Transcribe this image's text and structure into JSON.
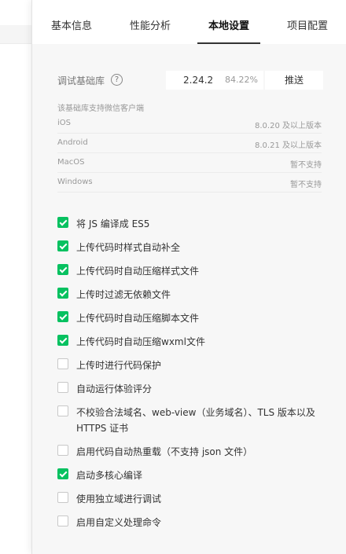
{
  "tabs": [
    {
      "label": "基本信息"
    },
    {
      "label": "性能分析"
    },
    {
      "label": "本地设置"
    },
    {
      "label": "项目配置"
    }
  ],
  "debug_lib": {
    "label": "调试基础库",
    "help_icon": "question-circle-icon",
    "version": "2.24.2",
    "percent": "84.22%",
    "push_label": "推送"
  },
  "support": {
    "title": "该基础库支持微信客户端",
    "rows": [
      {
        "os": "iOS",
        "version": "8.0.20 及以上版本"
      },
      {
        "os": "Android",
        "version": "8.0.21 及以上版本"
      },
      {
        "os": "MacOS",
        "version": "暂不支持"
      },
      {
        "os": "Windows",
        "version": "暂不支持"
      }
    ]
  },
  "options": [
    {
      "label": "将 JS 编译成 ES5",
      "checked": true
    },
    {
      "label": "上传代码时样式自动补全",
      "checked": true
    },
    {
      "label": "上传代码时自动压缩样式文件",
      "checked": true
    },
    {
      "label": "上传时过滤无依赖文件",
      "checked": true
    },
    {
      "label": "上传代码时自动压缩脚本文件",
      "checked": true
    },
    {
      "label": "上传代码时自动压缩wxml文件",
      "checked": true
    },
    {
      "label": "上传时进行代码保护",
      "checked": false
    },
    {
      "label": "自动运行体验评分",
      "checked": false
    },
    {
      "label": "不校验合法域名、web-view（业务域名）、TLS 版本以及 HTTPS 证书",
      "checked": false
    },
    {
      "label": "启用代码自动热重载（不支持 json 文件）",
      "checked": false
    },
    {
      "label": "启动多核心编译",
      "checked": true
    },
    {
      "label": "使用独立域进行调试",
      "checked": false
    },
    {
      "label": "启用自定义处理命令",
      "checked": false
    }
  ],
  "colors": {
    "accent": "#07c160"
  }
}
